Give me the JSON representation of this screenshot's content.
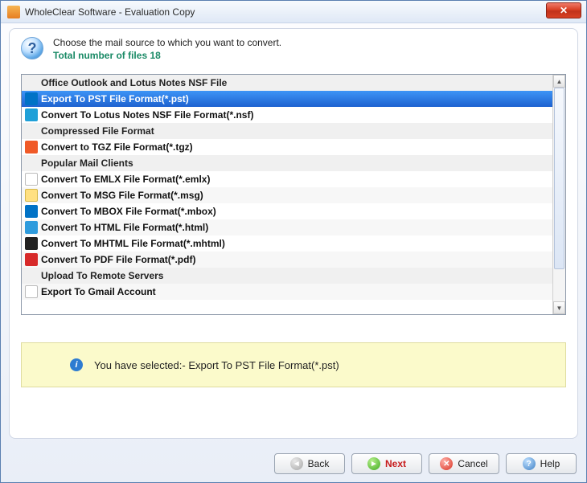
{
  "window": {
    "title": "WholeClear Software - Evaluation Copy"
  },
  "header": {
    "line1": "Choose the mail source to which you want to convert.",
    "line2_prefix": "Total number of files ",
    "file_count": "18"
  },
  "list": {
    "groups": [
      {
        "title": "Office Outlook and Lotus Notes NSF File",
        "items": [
          {
            "label": "Export To PST File Format(*.pst)",
            "icon": "outlook",
            "selected": true
          },
          {
            "label": "Convert To Lotus Notes NSF File Format(*.nsf)",
            "icon": "nsf"
          }
        ]
      },
      {
        "title": "Compressed File Format",
        "items": [
          {
            "label": "Convert to TGZ File Format(*.tgz)",
            "icon": "tgz"
          }
        ]
      },
      {
        "title": "Popular Mail Clients",
        "items": [
          {
            "label": "Convert To EMLX File Format(*.emlx)",
            "icon": "emlx"
          },
          {
            "label": "Convert To MSG File Format(*.msg)",
            "icon": "msg"
          },
          {
            "label": "Convert To MBOX File Format(*.mbox)",
            "icon": "mbox"
          },
          {
            "label": "Convert To HTML File Format(*.html)",
            "icon": "html"
          },
          {
            "label": "Convert To MHTML File Format(*.mhtml)",
            "icon": "mhtml"
          },
          {
            "label": "Convert To PDF File Format(*.pdf)",
            "icon": "pdf"
          }
        ]
      },
      {
        "title": "Upload To Remote Servers",
        "items": [
          {
            "label": "Export To Gmail Account",
            "icon": "gmail"
          }
        ]
      }
    ]
  },
  "notice": {
    "prefix": "You have selected:- ",
    "value": "Export To PST File Format(*.pst)"
  },
  "footer": {
    "back": "Back",
    "next": "Next",
    "cancel": "Cancel",
    "help": "Help"
  }
}
